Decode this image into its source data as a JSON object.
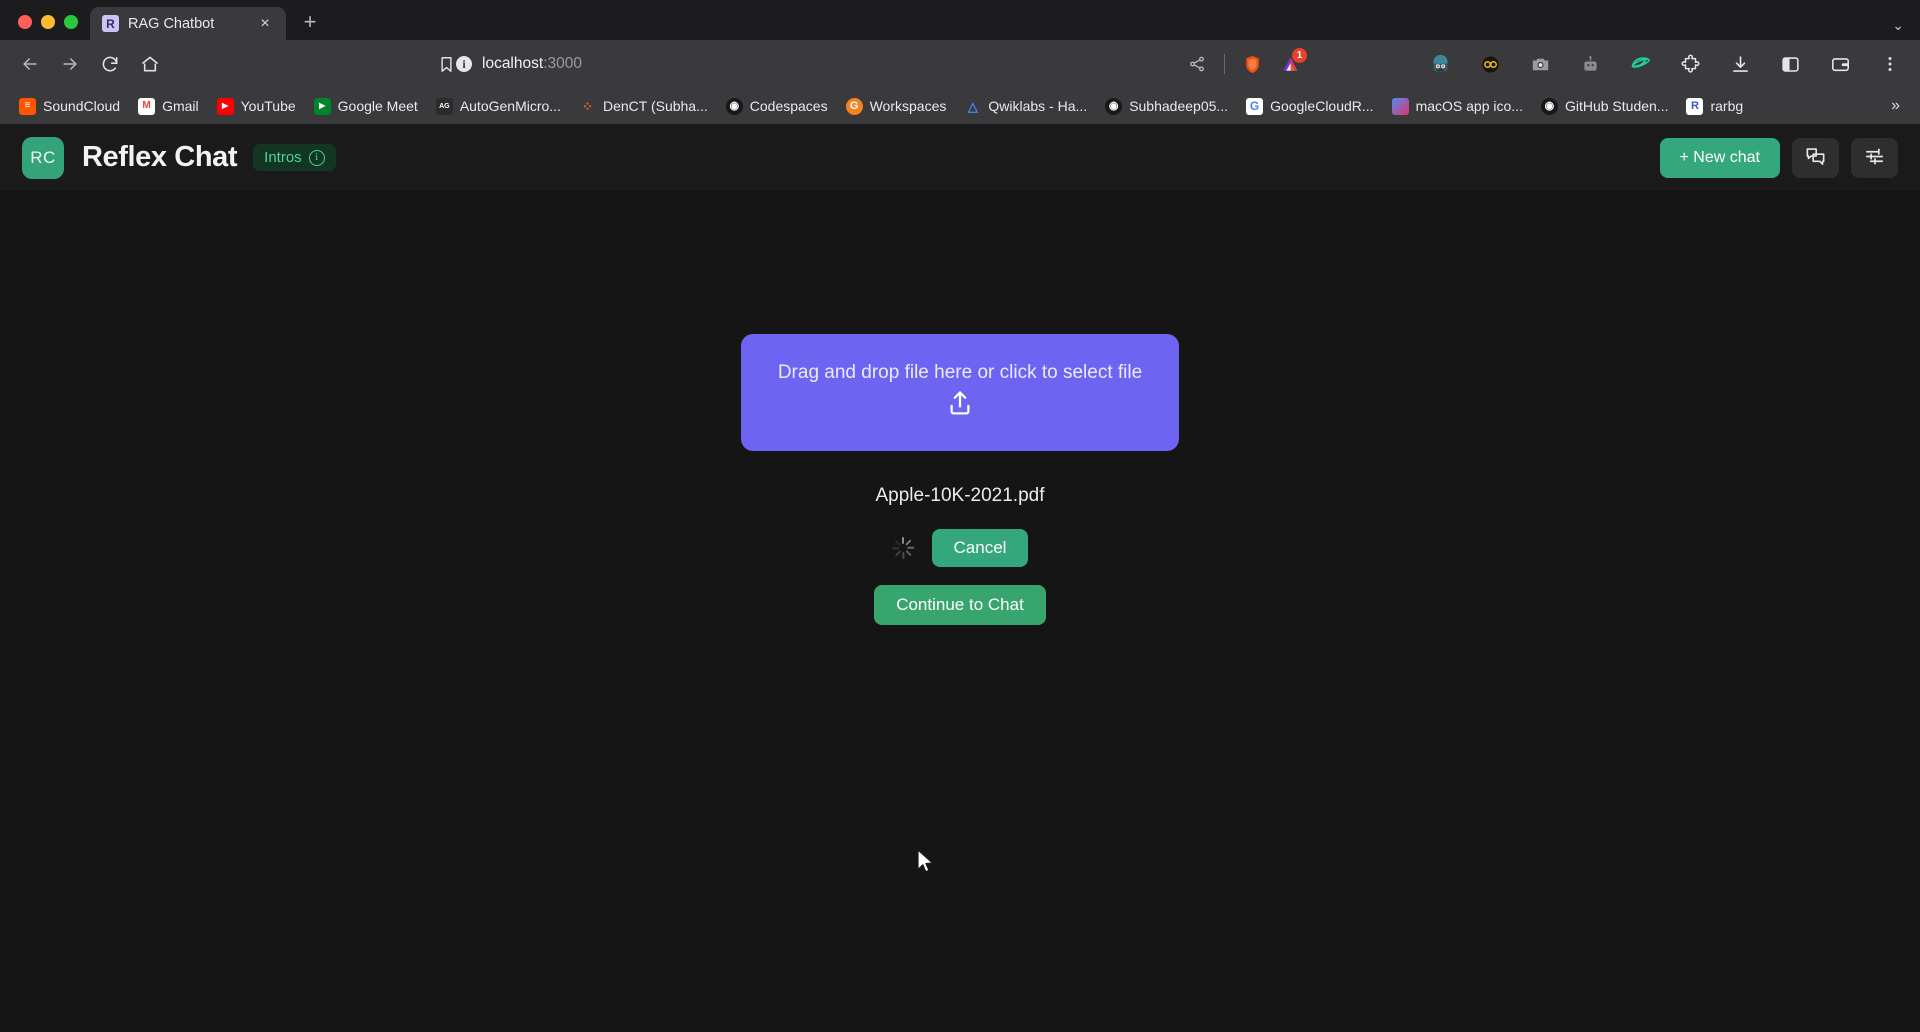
{
  "browser": {
    "tab": {
      "title": "RAG Chatbot",
      "favicon_letter": "R",
      "favicon_name": "reflex-favicon",
      "close_label": "×"
    },
    "new_tab_label": "+",
    "tabstrip_chevron": "⌄",
    "omnibox": {
      "host": "localhost",
      "port": ":3000",
      "info_glyph": "i"
    },
    "toolbar_icons": [
      "back-icon",
      "forward-icon",
      "reload-icon",
      "home-icon",
      "bookmark-icon",
      "share-icon",
      "brave-shields-icon",
      "extension-triangle-icon",
      "robot-avatar-icon",
      "infinity-glasses-icon",
      "camera-icon",
      "bot-icon",
      "leaf-icon",
      "puzzle-extensions-icon",
      "download-icon",
      "sidebar-panel-icon",
      "wallet-icon",
      "more-menu-icon"
    ],
    "shield_badge_count": "1",
    "bookmarks": [
      {
        "label": "SoundCloud",
        "icon": "soundcloud-icon",
        "color": "#ff5500",
        "glyph": "‖"
      },
      {
        "label": "Gmail",
        "icon": "gmail-icon",
        "color": "transparent",
        "glyph": "M"
      },
      {
        "label": "YouTube",
        "icon": "youtube-icon",
        "color": "#ff0000",
        "glyph": "▶"
      },
      {
        "label": "Google Meet",
        "icon": "google-meet-icon",
        "color": "#2f8e4e",
        "glyph": "▰"
      },
      {
        "label": "AutoGenMicro...",
        "icon": "autogen-icon",
        "color": "#2b2b2d",
        "glyph": "AG"
      },
      {
        "label": "DenCT (Subha...",
        "icon": "denct-icon",
        "color": "transparent",
        "glyph": "⁙"
      },
      {
        "label": "Codespaces",
        "icon": "github-codespaces-icon",
        "color": "#1d1d1f",
        "glyph": "●"
      },
      {
        "label": "Workspaces",
        "icon": "workspaces-icon",
        "color": "#f58220",
        "glyph": "G"
      },
      {
        "label": "Qwiklabs - Ha...",
        "icon": "qwiklabs-icon",
        "color": "transparent",
        "glyph": "△"
      },
      {
        "label": "Subhadeep05...",
        "icon": "github-icon",
        "color": "#1d1d1f",
        "glyph": "●"
      },
      {
        "label": "GoogleCloudR...",
        "icon": "google-icon",
        "color": "#ffffff",
        "glyph": "G"
      },
      {
        "label": "macOS app ico...",
        "icon": "macos-app-icon",
        "color": "#d6358f",
        "glyph": ""
      },
      {
        "label": "GitHub Studen...",
        "icon": "github-student-icon",
        "color": "#1d1d1f",
        "glyph": "●"
      },
      {
        "label": "rarbg",
        "icon": "rarbg-icon",
        "color": "#ffffff",
        "glyph": "R"
      }
    ],
    "bookmarks_overflow_label": "»"
  },
  "app": {
    "avatar_initials": "RC",
    "title": "Reflex Chat",
    "badge": {
      "label": "Intros",
      "info_glyph": "i"
    },
    "new_chat_label": "+ New chat",
    "chat_icon_name": "chat-bubbles-icon",
    "settings_icon_name": "sliders-settings-icon",
    "colors": {
      "accent_green": "#35a77c",
      "dropzone_purple": "#6d64f2",
      "badge_green_text": "#4fd39a",
      "badge_green_bg": "#133524"
    }
  },
  "main": {
    "dropzone_text": "Drag and drop file here or click to select file",
    "upload_icon_name": "upload-icon",
    "filename": "Apple-10K-2021.pdf",
    "spinner_name": "loading-spinner",
    "cancel_label": "Cancel",
    "continue_label": "Continue to Chat"
  }
}
